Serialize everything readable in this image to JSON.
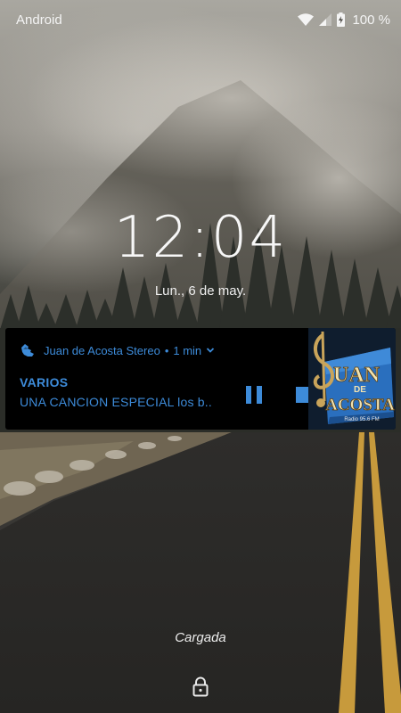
{
  "status_bar": {
    "carrier": "Android",
    "battery": "100 %",
    "icons": [
      "wifi-icon",
      "cell-signal-icon",
      "battery-charging-icon"
    ]
  },
  "lockscreen": {
    "time": "12:04",
    "date": "Lun., 6 de may.",
    "charging_status": "Cargada",
    "bottom_icon": "lock-icon"
  },
  "notification": {
    "app_name": "Juan de Acosta Stereo",
    "separator": "•",
    "time": "1 min",
    "title": "VARIOS",
    "text": "UNA CANCION ESPECIAL  los b..",
    "actions": [
      "pause-icon",
      "stop-icon"
    ],
    "accent_color": "#3d8bd9",
    "artwork": {
      "line1": "UAN",
      "line2": "DE",
      "line3": "ACOSTA",
      "footer": "Radio 95.6 FM"
    }
  }
}
